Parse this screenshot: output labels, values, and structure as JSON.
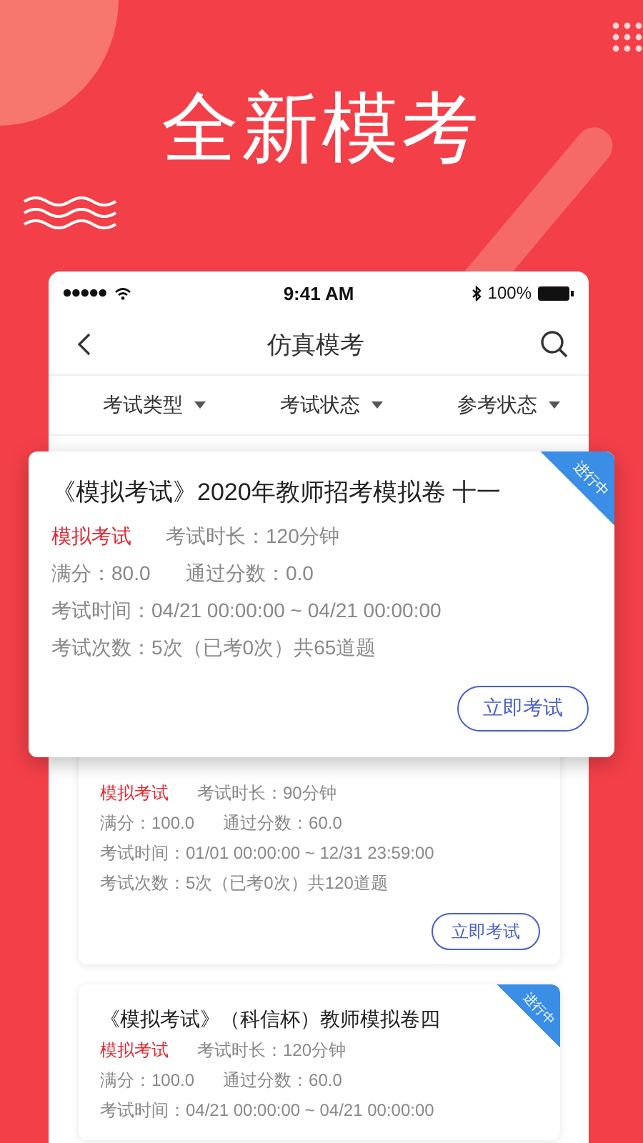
{
  "headline": "全新模考",
  "status_bar": {
    "time": "9:41 AM",
    "battery": "100%"
  },
  "nav": {
    "title": "仿真模考"
  },
  "filters": [
    {
      "label": "考试类型"
    },
    {
      "label": "考试状态"
    },
    {
      "label": "参考状态"
    }
  ],
  "featured_exam": {
    "title": "《模拟考试》2020年教师招考模拟卷 十一",
    "type": "模拟考试",
    "duration": "考试时长：120分钟",
    "full_score": "满分：80.0",
    "pass_score": "通过分数：0.0",
    "time": "考试时间：04/21 00:00:00 ~ 04/21 00:00:00",
    "attempts": "考试次数：5次（已考0次）共65道题",
    "status": "进行中",
    "button": "立即考试"
  },
  "exams": [
    {
      "type": "模拟考试",
      "duration": "考试时长：90分钟",
      "full_score": "满分：100.0",
      "pass_score": "通过分数：60.0",
      "time": "考试时间：01/01 00:00:00 ~ 12/31 23:59:00",
      "attempts": "考试次数：5次（已考0次）共120道题",
      "button": "立即考试"
    },
    {
      "title": "《模拟考试》（科信杯）教师模拟卷四",
      "status": "进行中",
      "type": "模拟考试",
      "duration": "考试时长：120分钟",
      "full_score": "满分：100.0",
      "pass_score": "通过分数：60.0",
      "time": "考试时间：04/21 00:00:00 ~ 04/21 00:00:00"
    }
  ]
}
